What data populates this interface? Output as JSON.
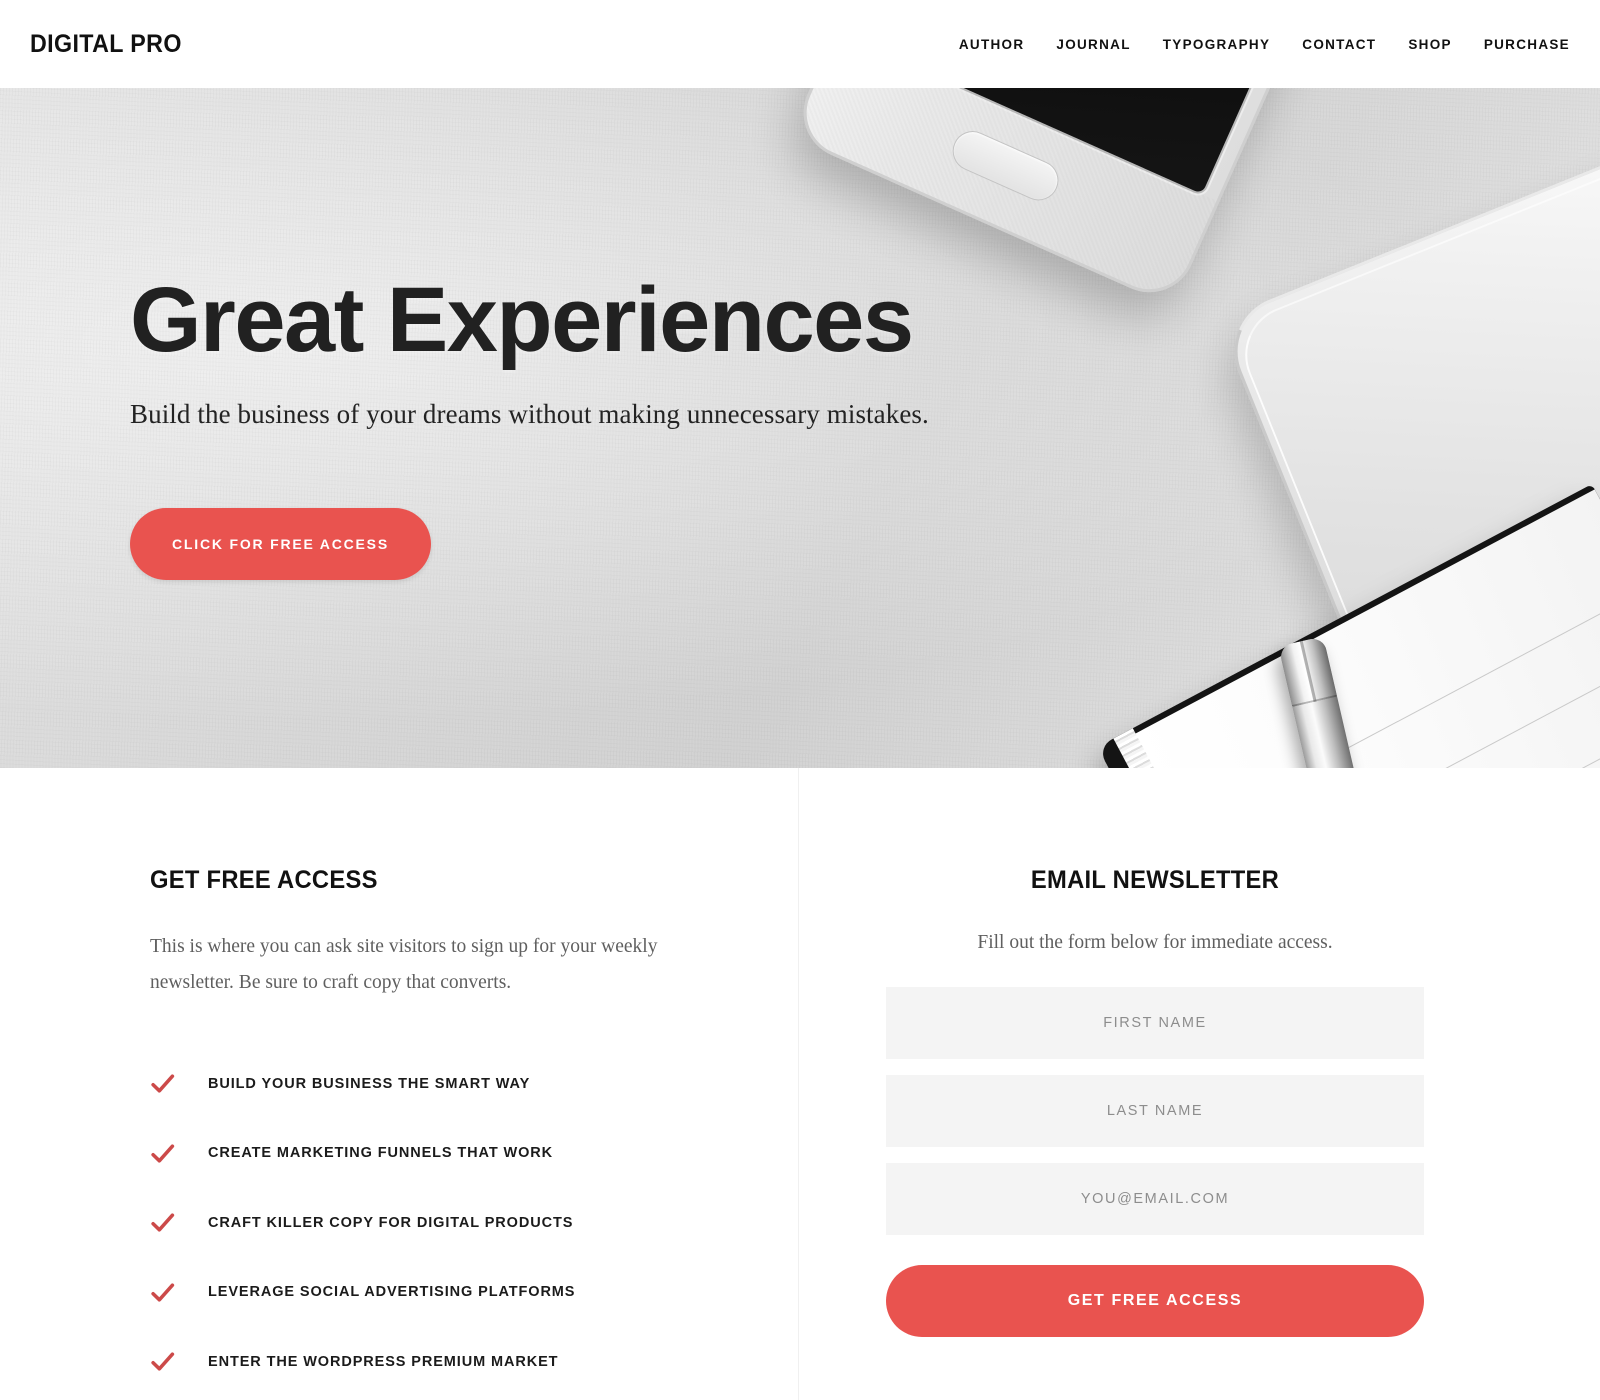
{
  "header": {
    "logo": "DIGITAL PRO",
    "nav": [
      {
        "label": "AUTHOR"
      },
      {
        "label": "JOURNAL"
      },
      {
        "label": "TYPOGRAPHY"
      },
      {
        "label": "CONTACT"
      },
      {
        "label": "SHOP"
      },
      {
        "label": "PURCHASE"
      }
    ]
  },
  "hero": {
    "title": "Great Experiences",
    "subtitle": "Build the business of your dreams without making unnecessary mistakes.",
    "cta_label": "Click For Free Access",
    "background_icons": [
      "smartphone",
      "laptop",
      "notebook",
      "pen"
    ]
  },
  "optin": {
    "left": {
      "heading": "Get Free Access",
      "paragraph": "This is where you can ask site visitors to sign up for your weekly newsletter. Be sure to craft copy that converts.",
      "checklist": [
        {
          "label": "Build Your Business The Smart Way",
          "icon": "check-icon"
        },
        {
          "label": "Create Marketing Funnels That Work",
          "icon": "check-icon"
        },
        {
          "label": "Craft Killer Copy For Digital Products",
          "icon": "check-icon"
        },
        {
          "label": "Leverage Social Advertising Platforms",
          "icon": "check-icon"
        },
        {
          "label": "Enter The WordPress Premium Market",
          "icon": "check-icon"
        }
      ]
    },
    "right": {
      "heading": "Email Newsletter",
      "paragraph": "Fill out the form below for immediate access.",
      "fields": [
        {
          "placeholder": "First Name",
          "value": ""
        },
        {
          "placeholder": "Last Name",
          "value": ""
        },
        {
          "placeholder": "you@email.com",
          "value": ""
        }
      ],
      "submit_label": "Get Free Access"
    }
  },
  "colors": {
    "accent": "#e9534f",
    "text": "#111111",
    "muted_text": "#5f5f5f",
    "field_bg": "#f4f4f4",
    "divider": "#f0f0f0",
    "page_bg": "#ffffff"
  }
}
